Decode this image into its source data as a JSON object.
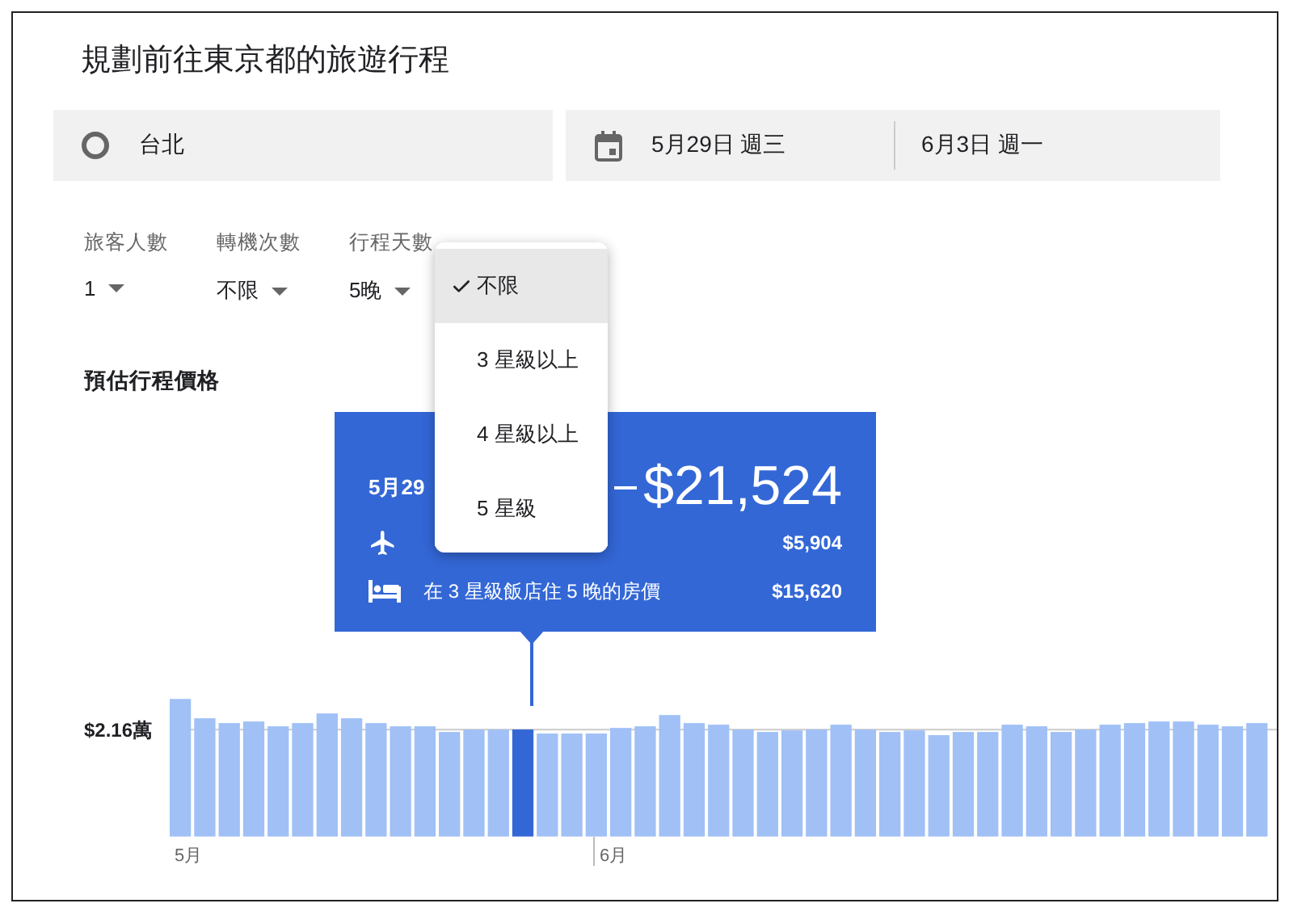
{
  "title": "規劃前往東京都的旅遊行程",
  "origin": {
    "value": "台北"
  },
  "dates": {
    "depart": "5月29日 週三",
    "return": "6月3日 週一"
  },
  "filters": [
    {
      "label": "旅客人數",
      "value": "1"
    },
    {
      "label": "轉機次數",
      "value": "不限"
    },
    {
      "label": "行程天數",
      "value": "5晚"
    }
  ],
  "menu": [
    {
      "label": "不限",
      "selected": true
    },
    {
      "label": "3 星級以上",
      "selected": false
    },
    {
      "label": "4 星級以上",
      "selected": false
    },
    {
      "label": "5 星級",
      "selected": false
    }
  ],
  "chart": {
    "title": "預估行程價格",
    "tick": "$2.16萬",
    "months": [
      "5月",
      "6月"
    ]
  },
  "tooltip": {
    "date": "5月29",
    "total": "$21,524",
    "rows": [
      {
        "kind": "flight",
        "price": "$5,904"
      },
      {
        "kind": "hotel",
        "text": "在 3 星級飯店住 5 晚的房價",
        "price": "$15,620"
      }
    ]
  }
}
